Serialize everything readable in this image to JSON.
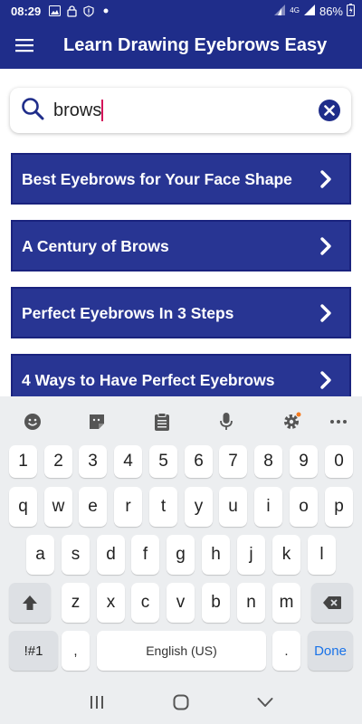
{
  "status_bar": {
    "time": "08:29",
    "icons": [
      "image-icon",
      "lock-icon",
      "alert-icon",
      "dot-icon"
    ],
    "network": "4G",
    "battery": "86%"
  },
  "app_bar": {
    "title": "Learn Drawing Eyebrows Easy",
    "menu_icon": "hamburger-menu-icon"
  },
  "search": {
    "value": "brows",
    "icon": "search-icon",
    "clear_icon": "clear-icon"
  },
  "results": [
    {
      "label": "Best Eyebrows for Your Face Shape"
    },
    {
      "label": "A Century of Brows"
    },
    {
      "label": "Perfect Eyebrows In 3 Steps"
    },
    {
      "label": "4 Ways to Have Perfect Eyebrows"
    }
  ],
  "keyboard": {
    "toolbar": [
      "emoji-icon",
      "sticker-icon",
      "clipboard-icon",
      "mic-icon",
      "settings-icon",
      "more-icon"
    ],
    "row_numbers": [
      "1",
      "2",
      "3",
      "4",
      "5",
      "6",
      "7",
      "8",
      "9",
      "0"
    ],
    "row_top": [
      "q",
      "w",
      "e",
      "r",
      "t",
      "y",
      "u",
      "i",
      "o",
      "p"
    ],
    "row_middle": [
      "a",
      "s",
      "d",
      "f",
      "g",
      "h",
      "j",
      "k",
      "l"
    ],
    "row_bottom": [
      "z",
      "x",
      "c",
      "v",
      "b",
      "n",
      "m"
    ],
    "symbols_label": "!#1",
    "comma_label": ",",
    "space_label": "English (US)",
    "period_label": ".",
    "done_label": "Done"
  },
  "nav_bar": [
    "recents-icon",
    "home-icon",
    "back-icon"
  ],
  "colors": {
    "primary": "#1f2d8a",
    "list_item": "#283593",
    "accent": "#1a73e8",
    "caret": "#d4145a"
  }
}
